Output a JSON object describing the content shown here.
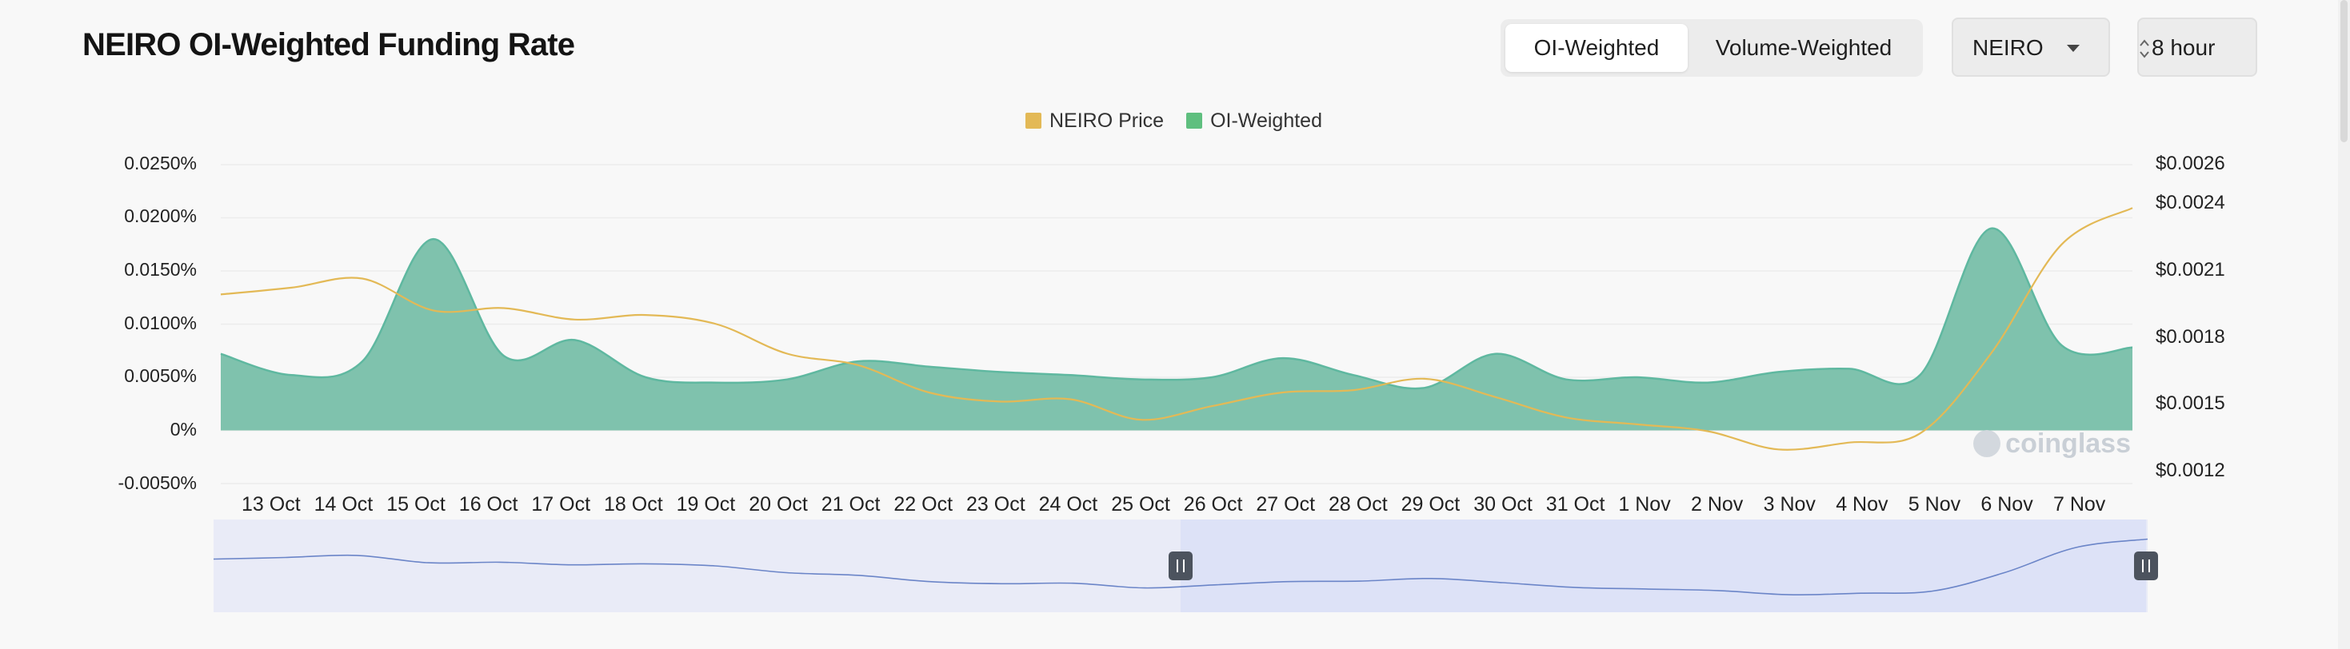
{
  "header": {
    "title": "NEIRO OI-Weighted Funding Rate",
    "toggle_oi": "OI-Weighted",
    "toggle_volume": "Volume-Weighted",
    "symbol": "NEIRO",
    "interval": "8 hour"
  },
  "legend": {
    "price": "NEIRO Price",
    "oi": "OI-Weighted"
  },
  "colors": {
    "price": "#e3b956",
    "oi": "#5fb8a0",
    "oi_fill": "#7fc2ad",
    "negative": "#e35b64",
    "grid": "#ececec",
    "navigator": "#dde2f7",
    "navigator_line": "#6b85c8",
    "accent": "#1f1f1f"
  },
  "icons": {
    "select_caret": "chevron-down-icon",
    "interval_stepper": "updown-icon",
    "handle": "pause-icon",
    "watermark": "coinglass-logo"
  },
  "chart_data": {
    "type": "area",
    "x": [
      "13 Oct",
      "14 Oct",
      "15 Oct",
      "16 Oct",
      "17 Oct",
      "18 Oct",
      "19 Oct",
      "20 Oct",
      "21 Oct",
      "22 Oct",
      "23 Oct",
      "24 Oct",
      "25 Oct",
      "26 Oct",
      "27 Oct",
      "28 Oct",
      "29 Oct",
      "30 Oct",
      "31 Oct",
      "1 Nov",
      "2 Nov",
      "3 Nov",
      "4 Nov",
      "5 Nov",
      "6 Nov",
      "7 Nov"
    ],
    "series": [
      {
        "name": "OI-Weighted",
        "axis": "left",
        "values": [
          0.0072,
          0.0052,
          0.0065,
          0.018,
          0.007,
          0.0085,
          0.005,
          0.0045,
          0.0048,
          0.0065,
          0.006,
          0.0055,
          0.0052,
          0.0048,
          0.005,
          0.0068,
          0.0052,
          0.004,
          0.0072,
          0.0048,
          0.005,
          0.0045,
          0.0055,
          0.0058,
          0.0052,
          0.019,
          0.008,
          0.0078
        ]
      },
      {
        "name": "NEIRO Price",
        "axis": "right",
        "values": [
          0.00203,
          0.00206,
          0.0021,
          0.00196,
          0.00197,
          0.00192,
          0.00194,
          0.0019,
          0.00177,
          0.00172,
          0.0016,
          0.00156,
          0.00157,
          0.00148,
          0.00154,
          0.0016,
          0.00161,
          0.00166,
          0.00158,
          0.00149,
          0.00146,
          0.00143,
          0.00135,
          0.00138,
          0.00142,
          0.00177,
          0.00225,
          0.00241
        ]
      }
    ],
    "left_axis": {
      "ticks": [
        "0.0250%",
        "0.0200%",
        "0.0150%",
        "0.0100%",
        "0.0050%",
        "0%",
        "-0.0050%"
      ],
      "range": [
        -0.005,
        0.025
      ]
    },
    "right_axis": {
      "ticks": [
        "$0.0026",
        "$0.0024",
        "$0.0021",
        "$0.0018",
        "$0.0015",
        "$0.0012"
      ],
      "range": [
        0.0012,
        0.0026
      ]
    },
    "xlabel": "",
    "ylabel": "",
    "grid": true,
    "legend_position": "top-center",
    "watermark": "coinglass"
  }
}
